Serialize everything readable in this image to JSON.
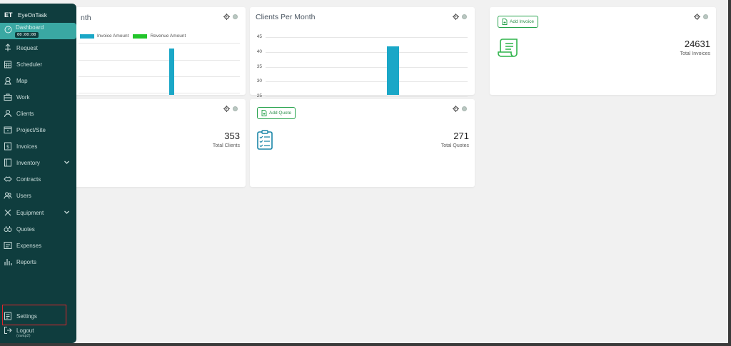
{
  "app": {
    "brand_logo": "ET",
    "brand_name": "EyeOnTask",
    "timer": "00:00:00"
  },
  "sidebar": {
    "active": {
      "label": "Dashboard",
      "icon": "dashboard-icon"
    },
    "items": [
      {
        "label": "Request",
        "icon": "request-icon"
      },
      {
        "label": "Scheduler",
        "icon": "calendar-icon"
      },
      {
        "label": "Map",
        "icon": "map-icon"
      },
      {
        "label": "Work",
        "icon": "briefcase-icon"
      },
      {
        "label": "Clients",
        "icon": "user-icon"
      },
      {
        "label": "Project/Site",
        "icon": "folder-icon"
      },
      {
        "label": "Invoices",
        "icon": "dollar-icon"
      },
      {
        "label": "Inventory",
        "icon": "inventory-icon"
      },
      {
        "label": "Contracts",
        "icon": "handshake-icon"
      },
      {
        "label": "Users",
        "icon": "users-icon"
      },
      {
        "label": "Equipment",
        "icon": "tools-icon"
      },
      {
        "label": "Quotes",
        "icon": "quotes-icon"
      },
      {
        "label": "Expenses",
        "icon": "expenses-icon"
      },
      {
        "label": "Reports",
        "icon": "chart-icon"
      }
    ],
    "settings": {
      "label": "Settings",
      "icon": "settings-icon"
    },
    "logout": {
      "label": "Logout",
      "sub": "(swap2)",
      "icon": "logout-icon"
    }
  },
  "cards": {
    "invoice_chart": {
      "title_fragment": "nth",
      "legend": [
        {
          "name": "Invoice Amount",
          "color": "#1aa7c7"
        },
        {
          "name": "Revenue Amount",
          "color": "#22c52a"
        }
      ]
    },
    "clients_per_month": {
      "title": "Clients Per Month"
    },
    "invoices_stat": {
      "button": "Add Invoice",
      "value": "24631",
      "label": "Total Invoices"
    },
    "clients_stat": {
      "value": "353",
      "label": "Total Clients"
    },
    "quotes_stat": {
      "button": "Add Quote",
      "value": "271",
      "label": "Total Quotes"
    }
  },
  "chart_data": [
    {
      "type": "bar",
      "title": "",
      "series": [
        {
          "name": "Invoice Amount",
          "values": [
            1
          ]
        },
        {
          "name": "Revenue Amount",
          "values": [
            0
          ]
        }
      ],
      "visible_fraction": 1
    },
    {
      "type": "bar",
      "title": "Clients Per Month",
      "y_ticks": [
        45,
        40,
        35,
        30,
        25
      ],
      "ylim": [
        24,
        47
      ],
      "values": [
        42
      ]
    }
  ],
  "colors": {
    "sidebar": "#0f3d3e",
    "active": "#3aa8a3",
    "accent_green": "#25a24b",
    "bar_blue": "#1aa7c7",
    "highlight_red": "#e0242a"
  }
}
